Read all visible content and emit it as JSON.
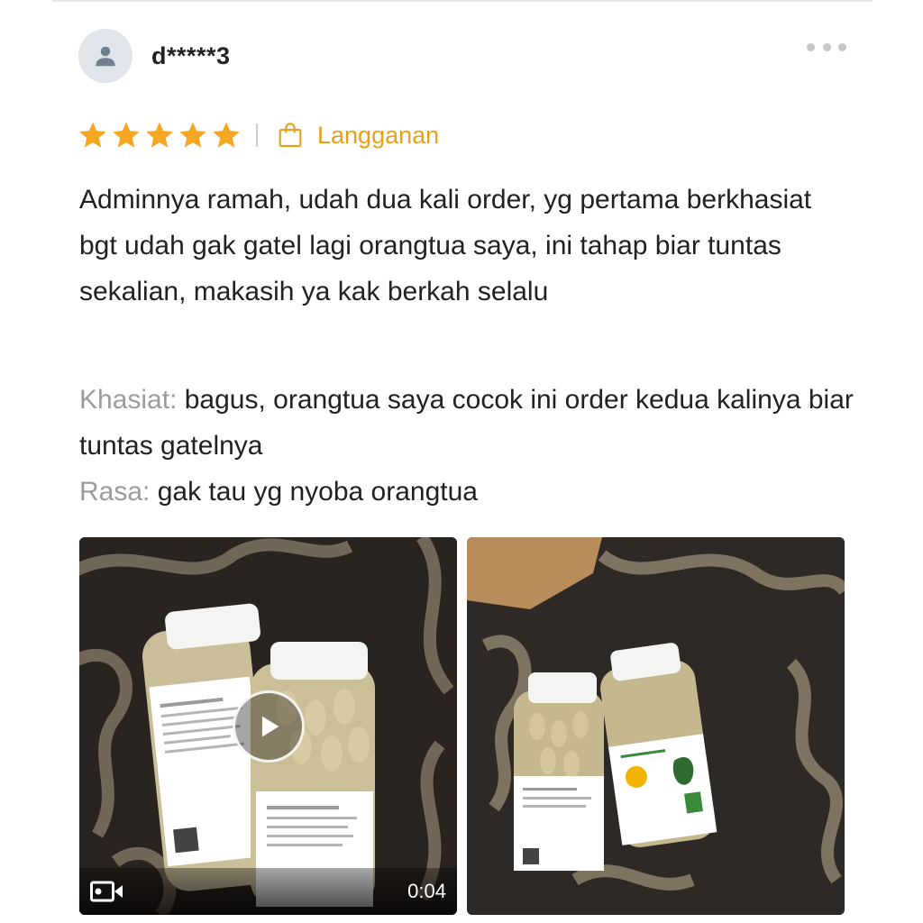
{
  "reviewer": {
    "name": "d*****3",
    "avatar_icon": "user-icon"
  },
  "rating": {
    "stars": 5,
    "max": 5,
    "star_color": "#f5a623"
  },
  "tag": {
    "icon": "shopping-bag-icon",
    "label": "Langganan",
    "color": "#e8a014"
  },
  "review_text": "Adminnya ramah, udah dua kali order, yg pertama berkhasiat bgt udah gak gatel lagi orangtua saya, ini tahap biar tuntas sekalian, makasih ya kak berkah selalu",
  "attributes": [
    {
      "key": "Khasiat:",
      "value": "bagus, orangtua saya cocok ini order kedua kalinya biar tuntas gatelnya"
    },
    {
      "key": "Rasa:",
      "value": "gak tau yg nyoba orangtua"
    }
  ],
  "media": {
    "video": {
      "duration": "0:04",
      "play_icon": "play-icon",
      "camera_icon": "video-camera-icon"
    },
    "photo": {}
  },
  "more_icon": "more-options-icon"
}
